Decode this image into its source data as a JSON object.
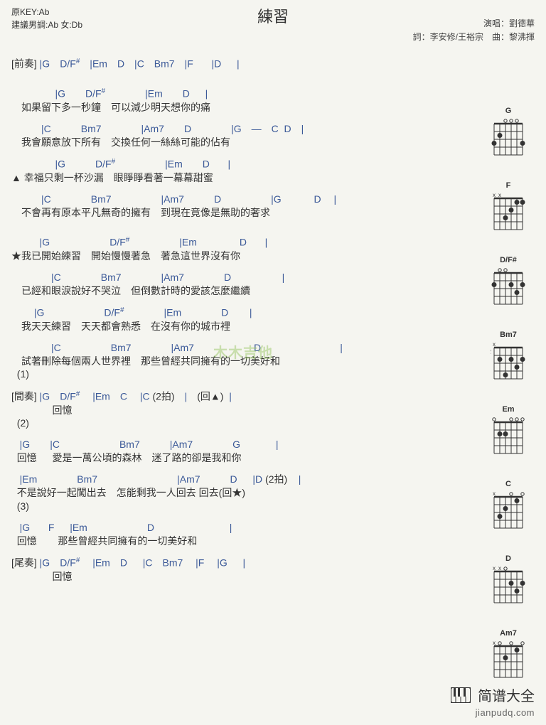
{
  "header": {
    "key_original": "原KEY:Ab",
    "key_suggest": "建議男調:Ab 女:Db",
    "title": "練習",
    "credit_singer": "演唱：劉德華",
    "credit_writer": "詞：李安修/王裕宗　曲：黎沸揮"
  },
  "lines": [
    {
      "c": "〔前奏〕 |G　D/F#　|Em　D　|C　Bm7　|F　   |D　  |",
      "l": ""
    },
    {
      "c": "",
      "l": ""
    },
    {
      "c": "　　　     |G　　D/F#　　　　|Em　　D　  |",
      "l": "　如果留下多一秒鐘　可以減少明天想你的痛"
    },
    {
      "c": "　　　|C　　　Bm7　　　　|Am7　　D　　　　|G　—　C  D　|",
      "l": "　我會願意放下所有　交換任何一絲絲可能的佔有"
    },
    {
      "c": "　　　     |G　　　D/F#　　　　　|Em　　D　   |",
      "l": "▲ 幸福只剩一杯沙漏　眼睜睜看著一幕幕甜蜜"
    },
    {
      "c": "　　　|C　　　　Bm7　　　　　|Am7　　　D　　　　　|G　　　 D　 |",
      "l": "　不會再有原本平凡無奇的擁有　到現在竟像是無助的奢求"
    },
    {
      "c": "",
      "l": ""
    },
    {
      "c": "　　   |G　　　　　　D/F#　　　　　|Em　　　　 D　   |",
      "l": "★我已開始練習　開始慢慢著急　著急這世界沒有你"
    },
    {
      "c": "　　　　|C　　　　Bm7　　　　|Am7　　　　D　　　　    |",
      "l": "　已經和眼淚說好不哭泣　但倒數計時的愛該怎麼繼續"
    },
    {
      "c": "　　 |G　　　　　　D/F#　　　　|Em　　　　D　    |",
      "l": "　我天天練習　天天都會熟悉　在沒有你的城市裡"
    },
    {
      "c": "　　　　|C　　　　　Bm7　　　　|Am7　　　　　　D　　　　　　       |",
      "l": "　試著刪除每個兩人世界裡　那些曾經共同擁有的一切美好和"
    },
    {
      "c": "",
      "l": "  (1)"
    },
    {
      "c": "〔間奏〕 |G　D/F#　 |Em　C　 |C (2拍)　|　(回▲)  |",
      "l": "　　　    回憶"
    },
    {
      "c": "",
      "l": "  (2)"
    },
    {
      "c": "   |G　　|C　　　　　　Bm7　　　|Am7　　　　G　　　  |",
      "l": "  回憶　  愛是一萬公頃的森林　迷了路的卻是我和你"
    },
    {
      "c": "   |Em　　　　Bm7　　　　　　　　|Am7　　　D　  |D (2拍)    |",
      "l": "  不是說好一起闖出去　怎能剩我一人回去 回去(回★)"
    },
    {
      "c": "",
      "l": "  (3)"
    },
    {
      "c": "   |G　   F　  |Em　　　　　　D　　　　　　　  |",
      "l": "  回憶　    那些曾經共同擁有的一切美好和"
    },
    {
      "c": "〔尾奏〕 |G　D/F#　 |Em　D　  |C　Bm7　 |F　 |G　  |",
      "l": "　　　    回憶"
    }
  ],
  "diagrams": [
    {
      "label": "G",
      "dots": [
        {
          "s": 5,
          "f": 2
        },
        {
          "s": 6,
          "f": 3
        },
        {
          "s": 1,
          "f": 3
        }
      ],
      "mute": [],
      "open": [
        2,
        3,
        4
      ]
    },
    {
      "label": "F",
      "dots": [
        {
          "s": 4,
          "f": 3
        },
        {
          "s": 3,
          "f": 2
        },
        {
          "s": 2,
          "f": 1
        },
        {
          "s": 1,
          "f": 1
        }
      ],
      "mute": [
        5,
        6
      ],
      "open": []
    },
    {
      "label": "D/F#",
      "dots": [
        {
          "s": 6,
          "f": 2
        },
        {
          "s": 3,
          "f": 2
        },
        {
          "s": 2,
          "f": 3
        },
        {
          "s": 1,
          "f": 2
        }
      ],
      "mute": [],
      "open": [
        4,
        5
      ]
    },
    {
      "label": "Bm7",
      "dots": [
        {
          "s": 5,
          "f": 2
        },
        {
          "s": 4,
          "f": 4
        },
        {
          "s": 3,
          "f": 2
        },
        {
          "s": 2,
          "f": 3
        },
        {
          "s": 1,
          "f": 2
        }
      ],
      "mute": [
        6
      ],
      "open": [],
      "fret_offset": "2"
    },
    {
      "label": "Em",
      "dots": [
        {
          "s": 5,
          "f": 2
        },
        {
          "s": 4,
          "f": 2
        }
      ],
      "mute": [],
      "open": [
        1,
        2,
        3,
        6
      ]
    },
    {
      "label": "C",
      "dots": [
        {
          "s": 5,
          "f": 3
        },
        {
          "s": 4,
          "f": 2
        },
        {
          "s": 2,
          "f": 1
        }
      ],
      "mute": [
        6
      ],
      "open": [
        1,
        3
      ]
    },
    {
      "label": "D",
      "dots": [
        {
          "s": 3,
          "f": 2
        },
        {
          "s": 2,
          "f": 3
        },
        {
          "s": 1,
          "f": 2
        }
      ],
      "mute": [
        5,
        6
      ],
      "open": [
        4
      ]
    },
    {
      "label": "Am7",
      "dots": [
        {
          "s": 4,
          "f": 2
        },
        {
          "s": 2,
          "f": 1
        }
      ],
      "mute": [
        6
      ],
      "open": [
        1,
        3,
        5
      ]
    }
  ],
  "footer": {
    "logo": "简谱大全",
    "url": "jianpudq.com"
  },
  "watermark": "木木吉他"
}
